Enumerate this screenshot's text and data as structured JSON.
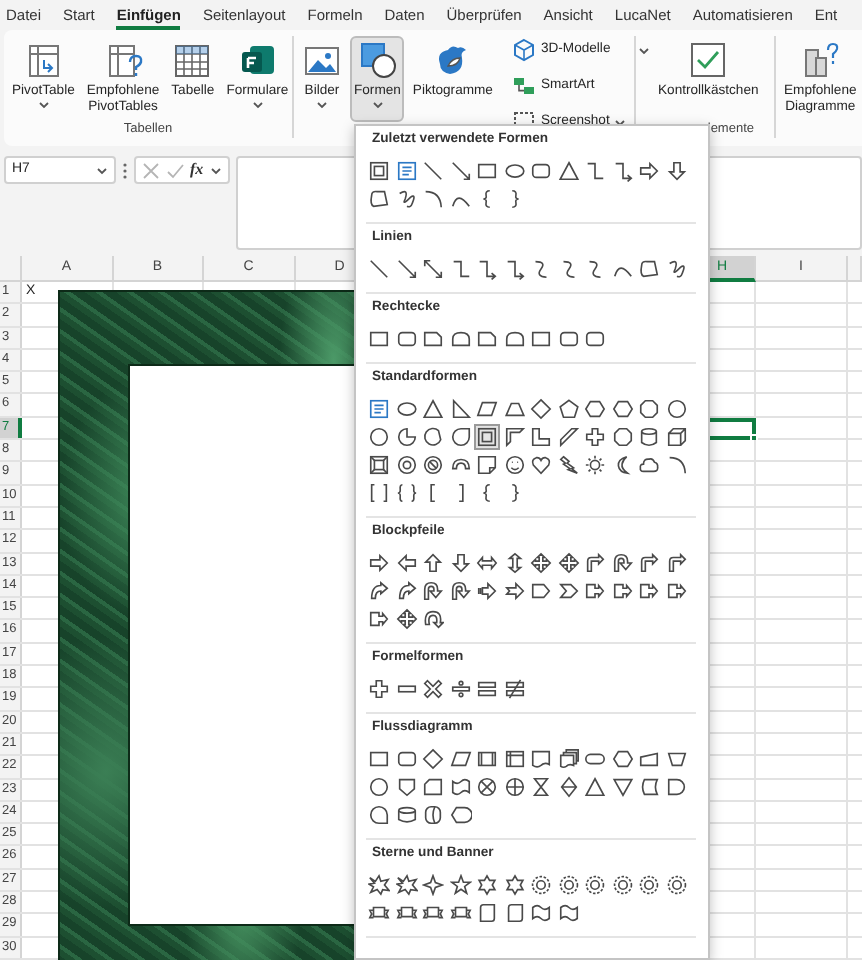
{
  "menu_tabs": [
    {
      "label": "Datei",
      "selected": false
    },
    {
      "label": "Start",
      "selected": false
    },
    {
      "label": "Einfügen",
      "selected": true
    },
    {
      "label": "Seitenlayout",
      "selected": false
    },
    {
      "label": "Formeln",
      "selected": false
    },
    {
      "label": "Daten",
      "selected": false
    },
    {
      "label": "Überprüfen",
      "selected": false
    },
    {
      "label": "Ansicht",
      "selected": false
    },
    {
      "label": "LucaNet",
      "selected": false
    },
    {
      "label": "Automatisieren",
      "selected": false
    },
    {
      "label": "Ent",
      "selected": false
    }
  ],
  "ribbon_groups": [
    {
      "label": "Tabellen",
      "buttons": [
        {
          "label": "PivotTable",
          "dropdown": true,
          "expanded": false
        },
        {
          "label": "Empfohlene PivotTables",
          "dropdown": false,
          "expanded": false
        },
        {
          "label": "Tabelle",
          "dropdown": false,
          "expanded": false
        },
        {
          "label": "Formulare",
          "dropdown": true,
          "expanded": false
        }
      ]
    },
    {
      "buttons": [
        {
          "label": "Bilder",
          "dropdown": true,
          "expanded": false
        },
        {
          "label": "Formen",
          "dropdown": true,
          "expanded": true
        },
        {
          "label": "Piktogramme",
          "dropdown": false,
          "expanded": false
        }
      ],
      "small_buttons": [
        {
          "label": "3D-Modelle",
          "dropdown": true
        },
        {
          "label": "SmartArt",
          "dropdown": false
        },
        {
          "label": "Screenshot",
          "dropdown": true
        }
      ]
    },
    {
      "label": "lemente",
      "buttons": [
        {
          "label": "Kontrollkästchen",
          "dropdown": false,
          "expanded": false
        }
      ]
    },
    {
      "buttons": [
        {
          "label": "Empfohlene Diagramme",
          "dropdown": false,
          "expanded": false
        }
      ]
    }
  ],
  "formula_bar": {
    "name_box": "H7",
    "function_button": "fx"
  },
  "sheet": {
    "columns": [
      {
        "label": "A",
        "selected": false
      },
      {
        "label": "B",
        "selected": false
      },
      {
        "label": "C",
        "selected": false
      },
      {
        "label": "D",
        "selected": false
      },
      {
        "label": "H",
        "selected": true
      },
      {
        "label": "I",
        "selected": false
      }
    ],
    "rows": [
      {
        "label": "1",
        "selected": false
      },
      {
        "label": "2",
        "selected": false
      },
      {
        "label": "3",
        "selected": false
      },
      {
        "label": "4",
        "selected": false
      },
      {
        "label": "5",
        "selected": false
      },
      {
        "label": "6",
        "selected": false
      },
      {
        "label": "7",
        "selected": true
      },
      {
        "label": "8",
        "selected": false
      },
      {
        "label": "9",
        "selected": false
      },
      {
        "label": "10",
        "selected": false
      },
      {
        "label": "11",
        "selected": false
      },
      {
        "label": "12",
        "selected": false
      },
      {
        "label": "13",
        "selected": false
      },
      {
        "label": "14",
        "selected": false
      },
      {
        "label": "15",
        "selected": false
      },
      {
        "label": "16",
        "selected": false
      },
      {
        "label": "17",
        "selected": false
      },
      {
        "label": "18",
        "selected": false
      },
      {
        "label": "19",
        "selected": false
      },
      {
        "label": "20",
        "selected": false
      },
      {
        "label": "21",
        "selected": false
      },
      {
        "label": "22",
        "selected": false
      },
      {
        "label": "23",
        "selected": false
      },
      {
        "label": "24",
        "selected": false
      },
      {
        "label": "25",
        "selected": false
      },
      {
        "label": "26",
        "selected": false
      },
      {
        "label": "27",
        "selected": false
      },
      {
        "label": "28",
        "selected": false
      },
      {
        "label": "29",
        "selected": false
      },
      {
        "label": "30",
        "selected": false
      }
    ],
    "cell_a1": "X"
  },
  "shapes_menu": {
    "sections": [
      {
        "title": "Zuletzt verwendete Formen"
      },
      {
        "title": "Linien"
      },
      {
        "title": "Rechtecke"
      },
      {
        "title": "Standardformen"
      },
      {
        "title": "Blockpfeile"
      },
      {
        "title": "Formelformen"
      },
      {
        "title": "Flussdiagramm"
      },
      {
        "title": "Sterne und Banner"
      }
    ]
  }
}
